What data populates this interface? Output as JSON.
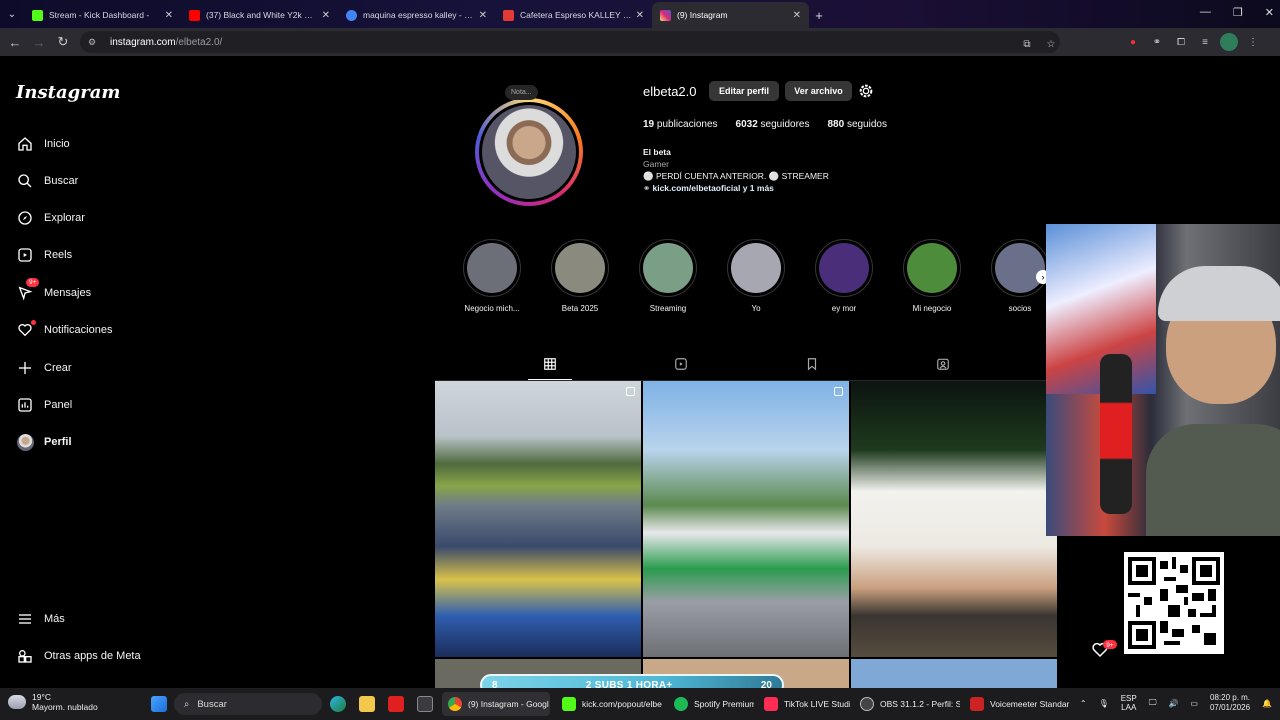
{
  "browser": {
    "tabs": [
      {
        "title": "Stream - Kick Dashboard -",
        "color": "#53fc18"
      },
      {
        "title": "(37) Black and White Y2k Neon",
        "color": "#ff0000"
      },
      {
        "title": "maquina espresso kalley - Busc",
        "color": "#4285f4"
      },
      {
        "title": "Cafetera Espreso KALLEY K-EX1",
        "color": "#e53935"
      },
      {
        "title": "(9) Instagram",
        "color": "#e1306c"
      }
    ],
    "url_host": "instagram.com",
    "url_path": "/elbeta2.0/"
  },
  "sidebar": {
    "logo": "Instagram",
    "items": [
      {
        "label": "Inicio",
        "icon": "home-icon"
      },
      {
        "label": "Buscar",
        "icon": "search-icon"
      },
      {
        "label": "Explorar",
        "icon": "compass-icon"
      },
      {
        "label": "Reels",
        "icon": "reels-icon"
      },
      {
        "label": "Mensajes",
        "icon": "messenger-icon",
        "badge": "9+"
      },
      {
        "label": "Notificaciones",
        "icon": "heart-icon"
      },
      {
        "label": "Crear",
        "icon": "plus-icon"
      },
      {
        "label": "Panel",
        "icon": "chart-icon"
      },
      {
        "label": "Perfil",
        "icon": "avatar-icon"
      }
    ],
    "bottom": [
      {
        "label": "Más",
        "icon": "menu-icon"
      },
      {
        "label": "Otras apps de Meta",
        "icon": "meta-apps-icon"
      }
    ]
  },
  "profile": {
    "note": "Nota...",
    "username": "elbeta2.0",
    "edit_label": "Editar perfil",
    "archive_label": "Ver archivo",
    "posts_count": "19",
    "posts_label": "publicaciones",
    "followers_count": "6032",
    "followers_label": "seguidores",
    "following_count": "880",
    "following_label": "seguidos",
    "bio_name": "El beta",
    "bio_category": "Gamer",
    "bio_text": "⚪ PERDÍ CUENTA ANTERIOR. ⚪ STREAMER",
    "bio_link": "kick.com/elbetaoficial y 1 más"
  },
  "highlights": [
    {
      "label": "Negocio mich...",
      "color": "#6d6f78"
    },
    {
      "label": "Beta 2025",
      "color": "#8a8a7e"
    },
    {
      "label": "Streaming",
      "color": "#7a9e86"
    },
    {
      "label": "Yo",
      "color": "#a7a7b2"
    },
    {
      "label": "ey mor",
      "color": "#4b2e7a"
    },
    {
      "label": "Mi negocio",
      "color": "#4c8c3a"
    },
    {
      "label": "socios",
      "color": "#6a6f8a"
    }
  ],
  "overlay": {
    "subs_left": "8",
    "subs_text": "2 SUBS 1 HORA+",
    "subs_right": "20",
    "notif_badge": "9+"
  },
  "taskbar": {
    "temp": "19°C",
    "weather": "Mayorm. nublado",
    "search": "Buscar",
    "apps": [
      {
        "label": "(9) Instagram - Googl",
        "color": "#4285f4",
        "active": true
      },
      {
        "label": "kick.com/popout/elbe",
        "color": "#53fc18"
      },
      {
        "label": "Spotify Premium",
        "color": "#1db954"
      },
      {
        "label": "TikTok LIVE Studi",
        "color": "#ff2d55"
      },
      {
        "label": "OBS 31.1.2 - Perfil: Sin",
        "color": "#444444"
      },
      {
        "label": "Voicemeeter Standar",
        "color": "#cc2222"
      }
    ],
    "lang1": "ESP",
    "lang2": "LAA",
    "time": "08:20 p. m.",
    "date": "07/01/2026"
  }
}
